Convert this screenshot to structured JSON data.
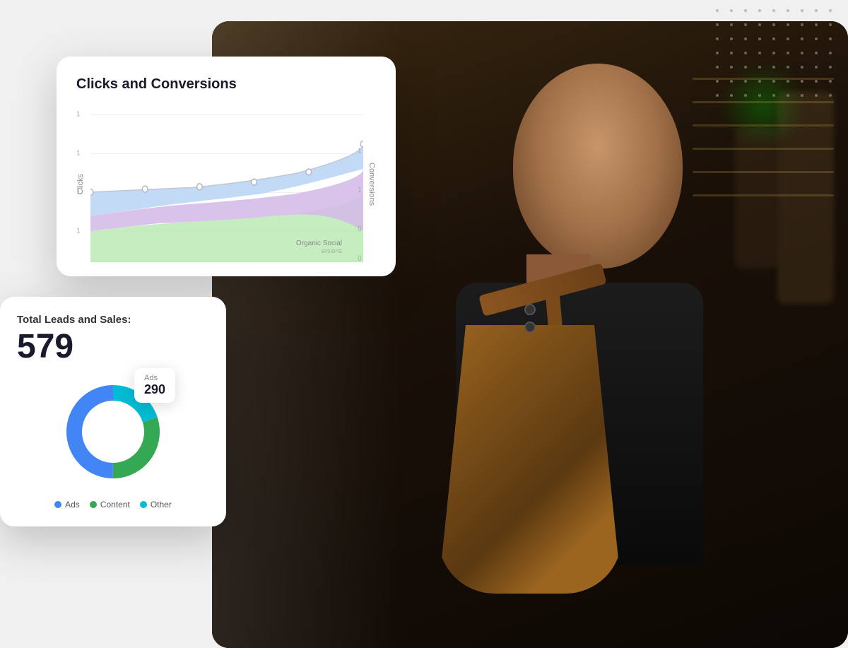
{
  "scene": {
    "dots_pattern_color": "#b0b0b0"
  },
  "clicks_card": {
    "title": "Clicks and Conversions",
    "y_axis_label": "Clicks",
    "y_axis_right_label": "Conversions",
    "grid_labels": [
      "1",
      "1",
      "1",
      "1"
    ],
    "organic_social_label": "Organic Social",
    "conversions_label": "ersions"
  },
  "leads_card": {
    "title": "Total Leads and Sales:",
    "total": "579",
    "tooltip": {
      "label": "Ads",
      "value": "290"
    },
    "legend": [
      {
        "label": "Ads",
        "color": "#4285f4"
      },
      {
        "label": "Content",
        "color": "#34a853"
      },
      {
        "label": "Other",
        "color": "#00bcd4"
      }
    ],
    "donut": {
      "ads_percent": 50,
      "content_percent": 30,
      "other_percent": 20
    }
  }
}
